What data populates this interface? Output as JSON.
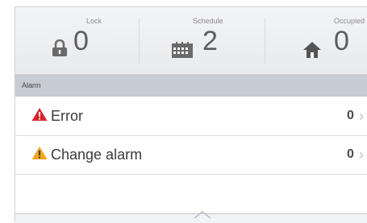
{
  "status": {
    "lock": {
      "label": "Lock",
      "value": "0",
      "icon": "lock-icon"
    },
    "schedule": {
      "label": "Schedule",
      "value": "2",
      "icon": "calendar-icon"
    },
    "occupied": {
      "label": "Occupied",
      "value": "0",
      "icon": "home-icon"
    }
  },
  "alarm_section": {
    "title": "Alarm"
  },
  "alarms": [
    {
      "label": "Error",
      "count": "0",
      "icon": "error-triangle-icon",
      "color": "#d6262b"
    },
    {
      "label": "Change alarm",
      "count": "0",
      "icon": "warning-triangle-icon",
      "color": "#f2a41c"
    }
  ],
  "colors": {
    "header_bg": "#c7ccd3",
    "status_bg": "#eceded",
    "text": "#5c5c5c"
  }
}
